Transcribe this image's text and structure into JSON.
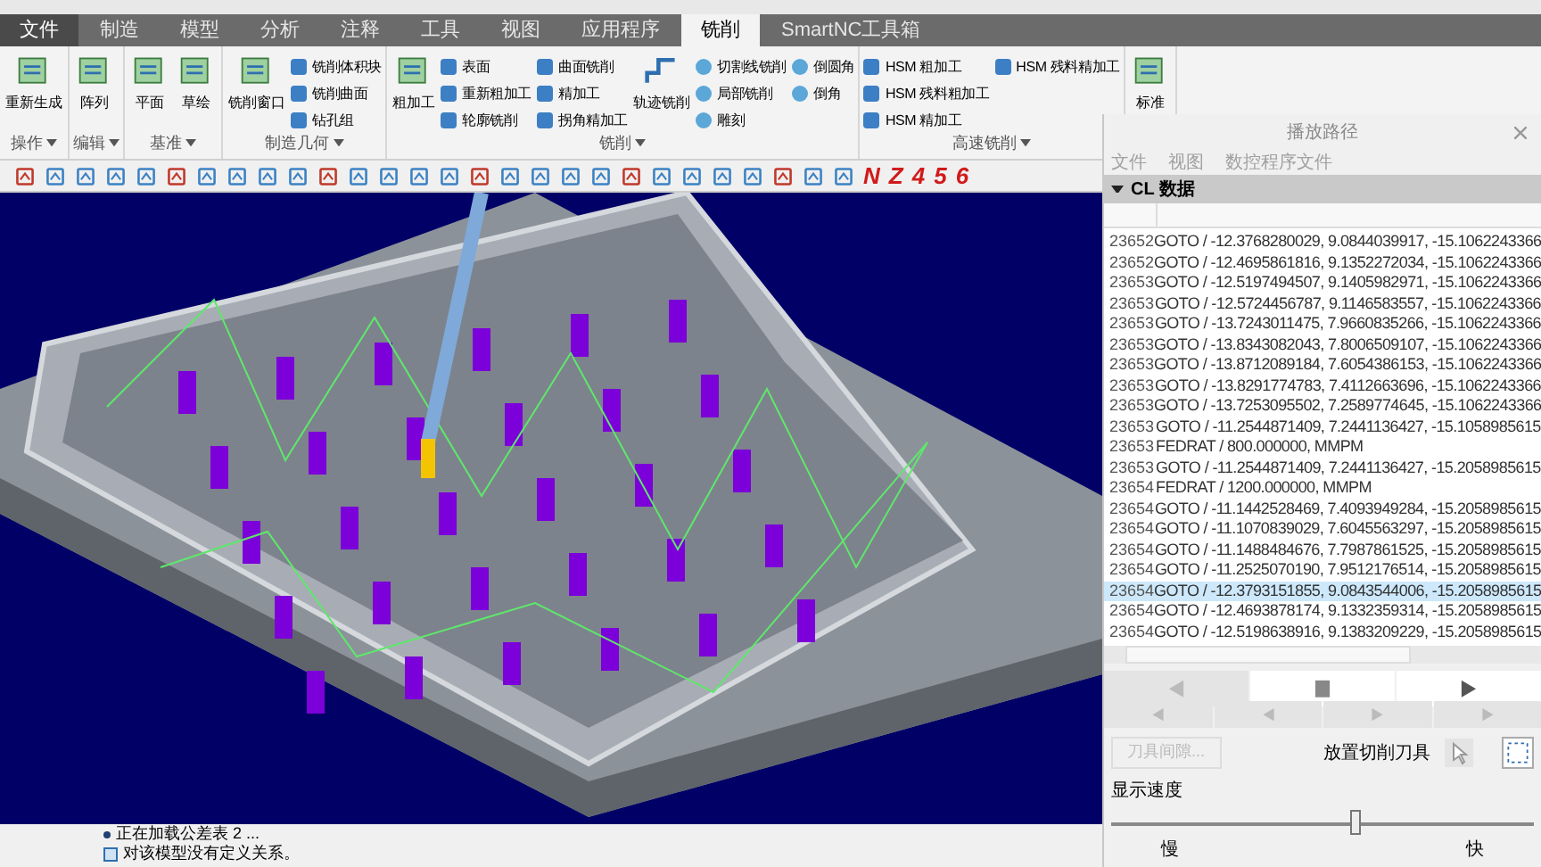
{
  "tabs": [
    {
      "label": "文件",
      "selected": false,
      "kind": "file"
    },
    {
      "label": "制造",
      "selected": false,
      "kind": "tab"
    },
    {
      "label": "模型",
      "selected": false,
      "kind": "tab"
    },
    {
      "label": "分析",
      "selected": false,
      "kind": "tab"
    },
    {
      "label": "注释",
      "selected": false,
      "kind": "tab"
    },
    {
      "label": "工具",
      "selected": false,
      "kind": "tab"
    },
    {
      "label": "视图",
      "selected": false,
      "kind": "tab"
    },
    {
      "label": "应用程序",
      "selected": false,
      "kind": "tab"
    },
    {
      "label": "铣削",
      "selected": true,
      "kind": "tab"
    },
    {
      "label": "SmartNC工具箱",
      "selected": false,
      "kind": "tab"
    }
  ],
  "ribbon_groups": [
    {
      "label": "操作",
      "large": [
        "重新生成"
      ]
    },
    {
      "label": "编辑",
      "large": [
        "阵列"
      ]
    },
    {
      "label": "基准",
      "large": [
        "平面",
        "草绘"
      ]
    },
    {
      "label": "制造几何",
      "large": [
        "铣削窗口"
      ],
      "small": [
        "铣削体积块",
        "铣削曲面",
        "钻孔组"
      ]
    },
    {
      "label": "铣削",
      "large": [
        "粗加工"
      ],
      "small": [
        "表面",
        "重新粗加工",
        "轮廓铣削",
        "曲面铣削",
        "精加工",
        "拐角精加工"
      ],
      "large2": [
        "轨迹铣削"
      ],
      "small2": [
        "切割线铣削",
        "局部铣削",
        "雕刻",
        "倒圆角",
        "倒角"
      ]
    },
    {
      "label": "高速铣削",
      "small": [
        "HSM 粗加工",
        "HSM 残料粗加工",
        "HSM 精加工",
        "HSM 残料精加工"
      ]
    },
    {
      "large": [
        "标准"
      ]
    }
  ],
  "toolbar": {
    "glyphs": [
      "N",
      "Z",
      "4",
      "5",
      "6"
    ]
  },
  "status_bar": {
    "messages": [
      "正在加载公差表 2 ...",
      "对该模型没有定义关系。"
    ]
  },
  "panel": {
    "title": "播放路径",
    "menu": [
      "文件",
      "视图",
      "数控程序文件"
    ],
    "section": "CL 数据",
    "rows": [
      {
        "number": "23652",
        "text": "GOTO / -12.3768280029, 9.0844039917, -15.1062243366",
        "selected": false
      },
      {
        "number": "23652",
        "text": "GOTO / -12.4695861816, 9.1352272034, -15.1062243366",
        "selected": false
      },
      {
        "number": "23653",
        "text": "GOTO / -12.5197494507, 9.1405982971, -15.1062243366",
        "selected": false
      },
      {
        "number": "23653",
        "text": "GOTO / -12.5724456787, 9.1146583557, -15.1062243366",
        "selected": false
      },
      {
        "number": "23653",
        "text": "GOTO / -13.7243011475, 7.9660835266, -15.1062243366",
        "selected": false
      },
      {
        "number": "23653",
        "text": "GOTO / -13.8343082043, 7.8006509107, -15.1062243366",
        "selected": false
      },
      {
        "number": "23653",
        "text": "GOTO / -13.8712089184, 7.6054386153, -15.1062243366",
        "selected": false
      },
      {
        "number": "23653",
        "text": "GOTO / -13.8291774783, 7.4112663696, -15.1062243366",
        "selected": false
      },
      {
        "number": "23653",
        "text": "GOTO / -13.7253095502, 7.2589774645, -15.1062243366",
        "selected": false
      },
      {
        "number": "23653",
        "text": "GOTO / -11.2544871409, 7.2441136427, -15.1058985615",
        "selected": false
      },
      {
        "number": "23653",
        "text": "FEDRAT / 800.000000,  MMPM",
        "selected": false
      },
      {
        "number": "23653",
        "text": "GOTO / -11.2544871409, 7.2441136427, -15.2058985615",
        "selected": false
      },
      {
        "number": "23654",
        "text": "FEDRAT / 1200.000000,  MMPM",
        "selected": false
      },
      {
        "number": "23654",
        "text": "GOTO / -11.1442528469, 7.4093949284, -15.2058985615",
        "selected": false
      },
      {
        "number": "23654",
        "text": "GOTO / -11.1070839029, 7.6045563297, -15.2058985615",
        "selected": false
      },
      {
        "number": "23654",
        "text": "GOTO / -11.1488484676, 7.7987861525, -15.2058985615",
        "selected": false
      },
      {
        "number": "23654",
        "text": "GOTO / -11.2525070190, 7.9512176514, -15.2058985615",
        "selected": false
      },
      {
        "number": "23654",
        "text": "GOTO / -12.3793151855, 9.0843544006, -15.2058985615",
        "selected": true
      },
      {
        "number": "23654",
        "text": "GOTO / -12.4693878174, 9.1332359314, -15.2058985615",
        "selected": false
      },
      {
        "number": "23654",
        "text": "GOTO / -12.5198638916, 9.1383209229, -15.2058985615",
        "selected": false
      }
    ],
    "clearance_button": {
      "label": "刀具间隙...",
      "disabled": true
    },
    "place_tool_label": "放置切削刀具",
    "speed": {
      "label": "显示速度",
      "level": 0.58,
      "min_label": "慢",
      "max_label": "快"
    }
  }
}
